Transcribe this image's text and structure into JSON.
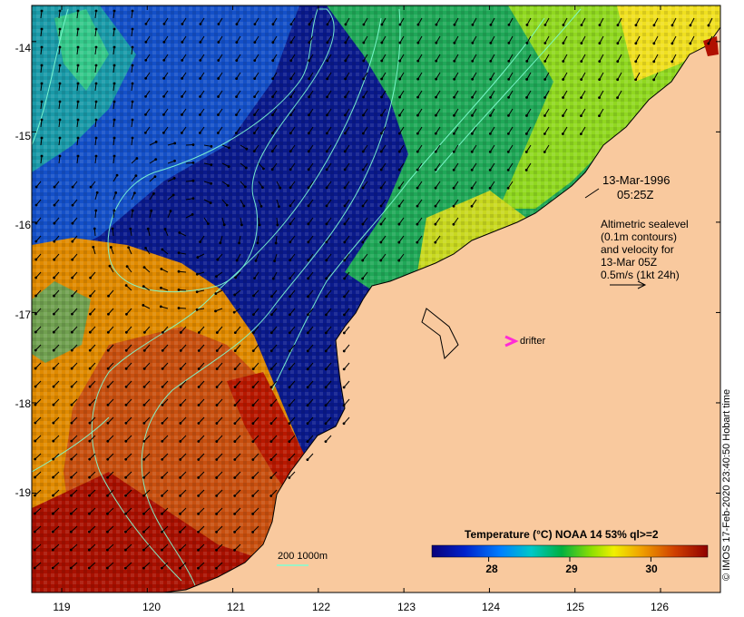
{
  "map": {
    "x_ticks": [
      "119",
      "120",
      "121",
      "122",
      "123",
      "124",
      "125",
      "126"
    ],
    "y_ticks": [
      "-14",
      "-15",
      "-16",
      "-17",
      "-18",
      "-19"
    ],
    "x_range": [
      118.65,
      126.7
    ],
    "y_range": [
      -20.1,
      -13.6
    ],
    "date_label": "13-Mar-1996",
    "time_label": "05:25Z",
    "legend_lines": [
      "Altimetric sealevel",
      "(0.1m contours)",
      "and velocity for",
      "13-Mar 05Z",
      "0.5m/s (1kt 24h)"
    ],
    "drifter_label": "drifter",
    "scale_bar_label": "200  1000m",
    "credit": "© IMOS 17-Feb-2020 23:40:50 Hobart time",
    "colorbar": {
      "title": "Temperature (°C) NOAA 14 53% ql>=2",
      "ticks": [
        "28",
        "29",
        "30"
      ],
      "range": [
        27.3,
        30.7
      ]
    },
    "colors": {
      "land": "#f9c99e",
      "deep_blue": "#0a1a8c",
      "contour": "#7fffd4",
      "drifter": "#ff2bd6",
      "warm": "#b01000"
    }
  }
}
